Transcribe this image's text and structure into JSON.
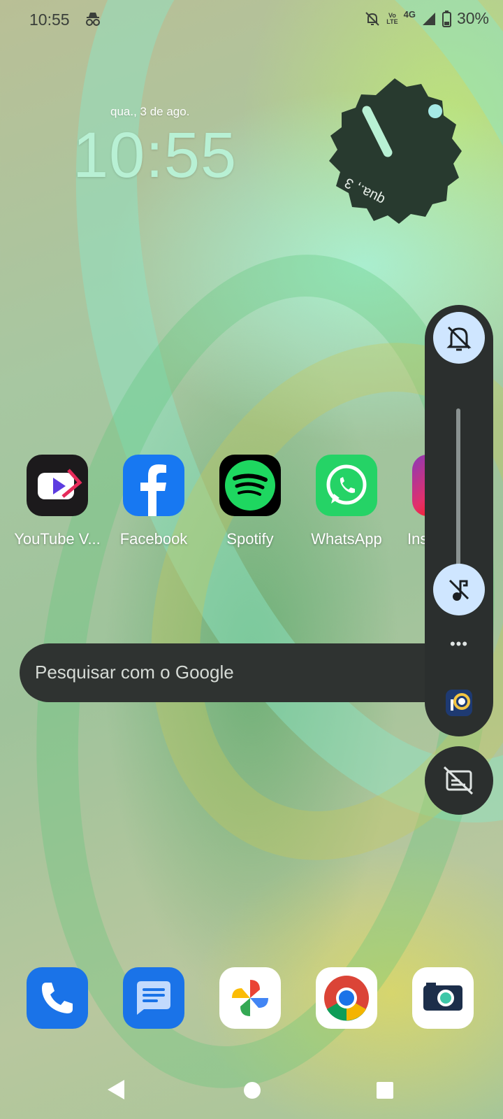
{
  "status_bar": {
    "time": "10:55",
    "incognito_icon": "incognito-icon",
    "silent_icon": "bell-off-icon",
    "volte_line1": "Vo",
    "volte_line2": "LTE",
    "network": "4G",
    "battery": "30%"
  },
  "clock_widget": {
    "date": "qua., 3 de ago.",
    "time": "10:55",
    "analog_date": "qua., 3"
  },
  "apps": [
    {
      "label": "YouTube V...",
      "icon": "youtube-vanced-icon"
    },
    {
      "label": "Facebook",
      "icon": "facebook-icon"
    },
    {
      "label": "Spotify",
      "icon": "spotify-icon"
    },
    {
      "label": "WhatsApp",
      "icon": "whatsapp-icon"
    },
    {
      "label": "Ins",
      "icon": "instagram-icon"
    }
  ],
  "search": {
    "placeholder": "Pesquisar com o Google"
  },
  "volume_panel": {
    "ringer_icon": "bell-off-icon",
    "level": 0,
    "media_icon": "music-off-icon",
    "more": "•••",
    "app_icon": "ibis-paint-icon",
    "caption_icon": "captions-off-icon"
  },
  "dock": [
    {
      "icon": "phone-icon"
    },
    {
      "icon": "messages-icon"
    },
    {
      "icon": "google-photos-icon"
    },
    {
      "icon": "chrome-icon"
    },
    {
      "icon": "camera-icon"
    }
  ],
  "nav": {
    "back": "back-icon",
    "home": "home-icon",
    "recents": "recents-icon"
  },
  "colors": {
    "clock_accent": "#b8f0d4",
    "panel_bg": "#2b2f2e",
    "panel_button": "#cfe6ff"
  }
}
